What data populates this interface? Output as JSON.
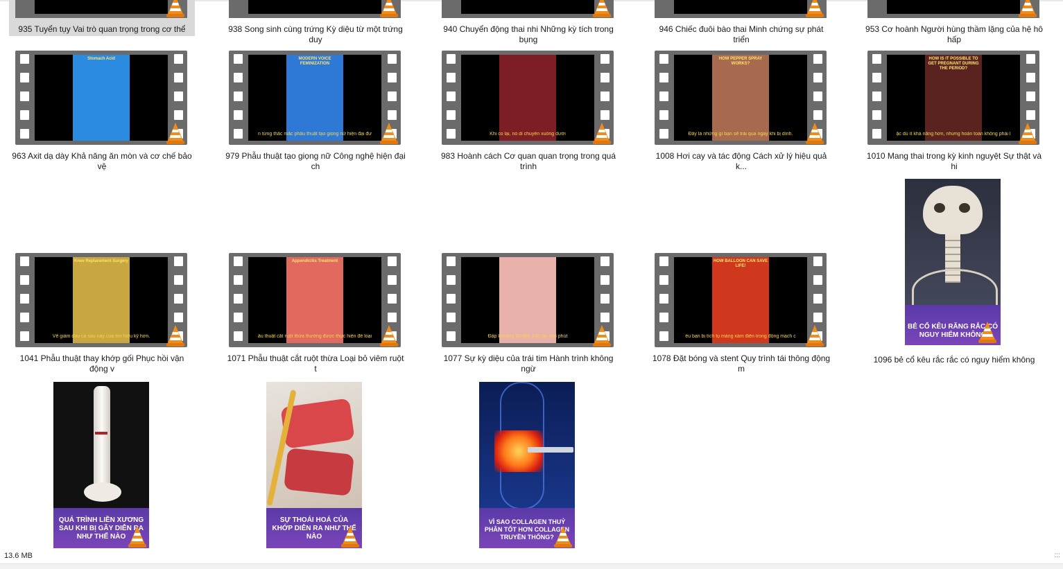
{
  "top_row": [
    {
      "label": "935 Tuyển tụy Vai trò quan trọng trong cơ thể",
      "selected": true
    },
    {
      "label": "938 Song sinh cùng trứng Kỳ diệu từ một trứng duy"
    },
    {
      "label": "940 Chuyển động thai nhi Những kỳ tích trong bụng"
    },
    {
      "label": "946 Chiếc đuôi bào thai Minh chứng sự phát triển"
    },
    {
      "label": "953 Cơ hoành Người hùng thầm lặng của hệ hô hấp"
    }
  ],
  "row2": [
    {
      "label": "963 Axit dạ dày Khả năng ăn mòn và cơ chế bảo vệ",
      "title": "Stomach Acid",
      "caption": "",
      "color": "#2a8be0"
    },
    {
      "label": "979 Phẫu thuật tạo giọng nữ Công nghệ hiện đại ch",
      "title": "MODERN VOICE FEMINIZATION",
      "caption": "n từng thắc mắc phẫu thuật tạo giọng nữ hiện đại đư",
      "color": "#2e78d6"
    },
    {
      "label": "983 Hoành cách Cơ quan quan trọng trong quá trình",
      "title": "",
      "caption": "Khi co lại, nó di chuyển xuống dưới",
      "color": "#7d1e24"
    },
    {
      "label": "1008 Hơi cay và tác động Cách xử lý hiệu quả k...",
      "title": "HOW PEPPER SPRAY WORKS?",
      "caption": "Đây là những gì bạn sẽ trải qua ngay khi bị dính.",
      "color": "#a86a4e"
    },
    {
      "label": "1010 Mang thai trong kỳ kinh nguyệt Sự thật và hi",
      "title": "HOW IS IT POSSIBLE TO GET PREGNANT DURING THE PERIOD?",
      "caption": "ặc dù ít khả năng hơn, nhưng hoàn toàn không phải l",
      "color": "#5b2320"
    }
  ],
  "row3": [
    {
      "label": "1041 Phẫu thuật thay khớp gối Phục hồi vận động v",
      "title": "Knee Replacement Surgery",
      "caption": "Vẽ giảm đau cả sau này của tìm hiểu kỹ hơn.",
      "color": "#c8a640"
    },
    {
      "label": "1071 Phẫu thuật cắt ruột thừa Loại bỏ viêm ruột t",
      "title": "Appendicitis Treatment",
      "caption": "ẫu thuật cắt ruột thừa thường được thực hiện để loại",
      "color": "#e06a5e"
    },
    {
      "label": "1077 Sự kỳ diệu của trái tim Hành trình không ngừ",
      "title": "",
      "caption": "Đập khoảng 60 đến 100 lần mỗi phút",
      "color": "#e7b0a8"
    },
    {
      "label": "1078 Đặt bóng và stent Quy trình tái thông động m",
      "title": "HOW BALLOON CAN SAVE LIFE!",
      "caption": "ếu bạn bị tích tụ mảng xám điển trong động mạch c",
      "color": "#d0381e"
    }
  ],
  "poster_1096": {
    "label": "1096 bẻ cổ kêu rắc rắc có nguy hiểm không",
    "text": "BẺ CỔ KÊU RĂNG RẮC CÓ NGUY HIỂM KHÔNG"
  },
  "row4": [
    {
      "text": "QUÁ TRÌNH LIỀN XƯƠNG SAU KHI BỊ GÃY DIỄN RA NHƯ THẾ NÀO"
    },
    {
      "text": "SỰ THOÁI HOÁ CỦA KHỚP DIỄN RA NHƯ THẾ NÀO"
    },
    {
      "text": "VÌ SAO COLLAGEN THUỶ PHÂN TỐT HƠN COLLAGEN TRUYỀN THỐNG?"
    }
  ],
  "status": {
    "size": "13.6 MB",
    "grip": ":::"
  },
  "colors": {
    "selection": "#cce8ff",
    "vlc_orange": "#f08c1a",
    "poster_band": "#6a3fb0"
  }
}
